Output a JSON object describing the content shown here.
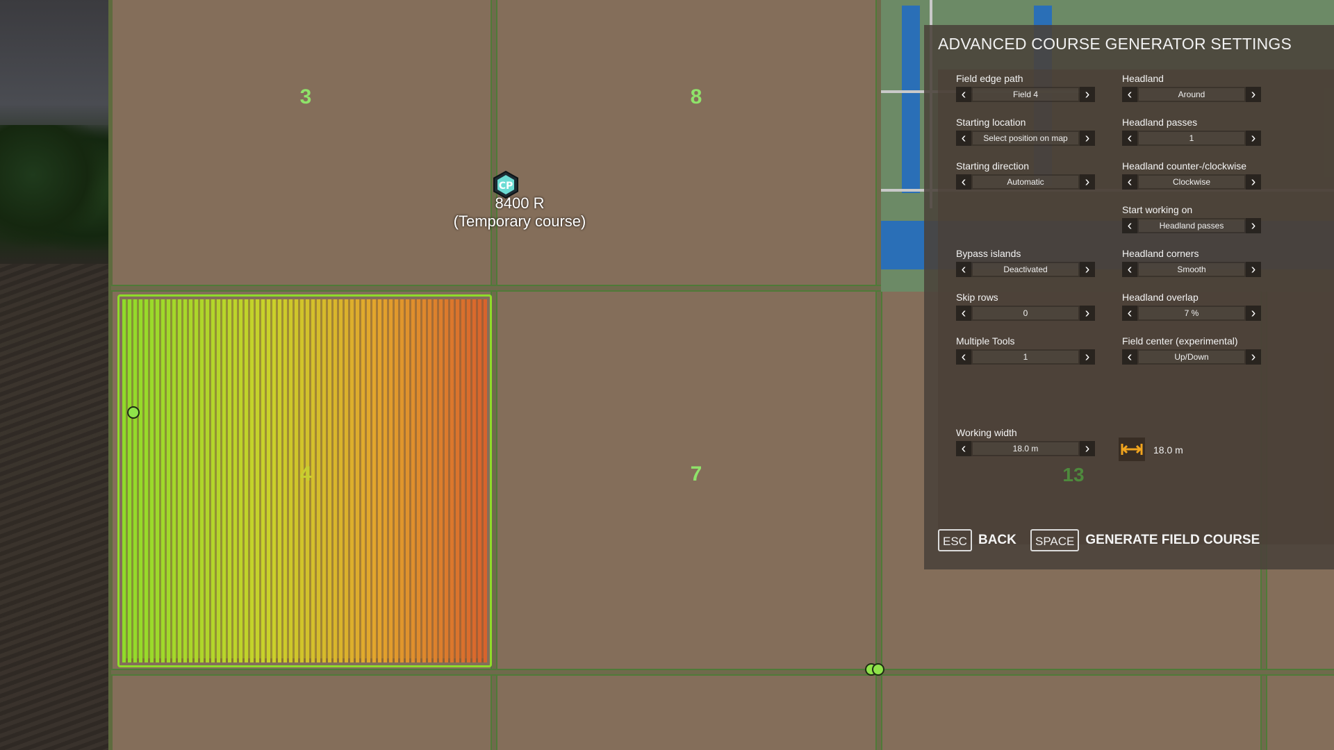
{
  "map": {
    "field_numbers": [
      "3",
      "8",
      "4",
      "7",
      "13"
    ],
    "vehicle": {
      "icon": "cp-icon",
      "name": "8400 R",
      "course_label": "(Temporary course)"
    }
  },
  "panel": {
    "title": "ADVANCED COURSE GENERATOR SETTINGS",
    "left_column": [
      {
        "label": "Field edge path",
        "value": "Field 4"
      },
      {
        "label": "Starting location",
        "value": "Select position on map"
      },
      {
        "label": "Starting direction",
        "value": "Automatic"
      },
      {
        "label": "Bypass islands",
        "value": "Deactivated"
      },
      {
        "label": "Skip rows",
        "value": "0"
      },
      {
        "label": "Multiple Tools",
        "value": "1"
      },
      {
        "label": "Working width",
        "value": "18.0 m"
      }
    ],
    "right_column": [
      {
        "label": "Headland",
        "value": "Around"
      },
      {
        "label": "Headland passes",
        "value": "1"
      },
      {
        "label": "Headland counter-/clockwise",
        "value": "Clockwise"
      },
      {
        "label": "Start working on",
        "value": "Headland passes"
      },
      {
        "label": "Headland corners",
        "value": "Smooth"
      },
      {
        "label": "Headland overlap",
        "value": "7 %"
      },
      {
        "label": "Field center (experimental)",
        "value": "Up/Down"
      }
    ],
    "working_width_display": "18.0 m",
    "footer": {
      "back_key": "ESC",
      "back_label": "BACK",
      "generate_key": "SPACE",
      "generate_label": "GENERATE FIELD COURSE"
    }
  },
  "colors": {
    "field": "#846e5a",
    "course_start": "#8fdc2a",
    "course_end": "#d8622c",
    "field_number": "#8fe36a"
  }
}
